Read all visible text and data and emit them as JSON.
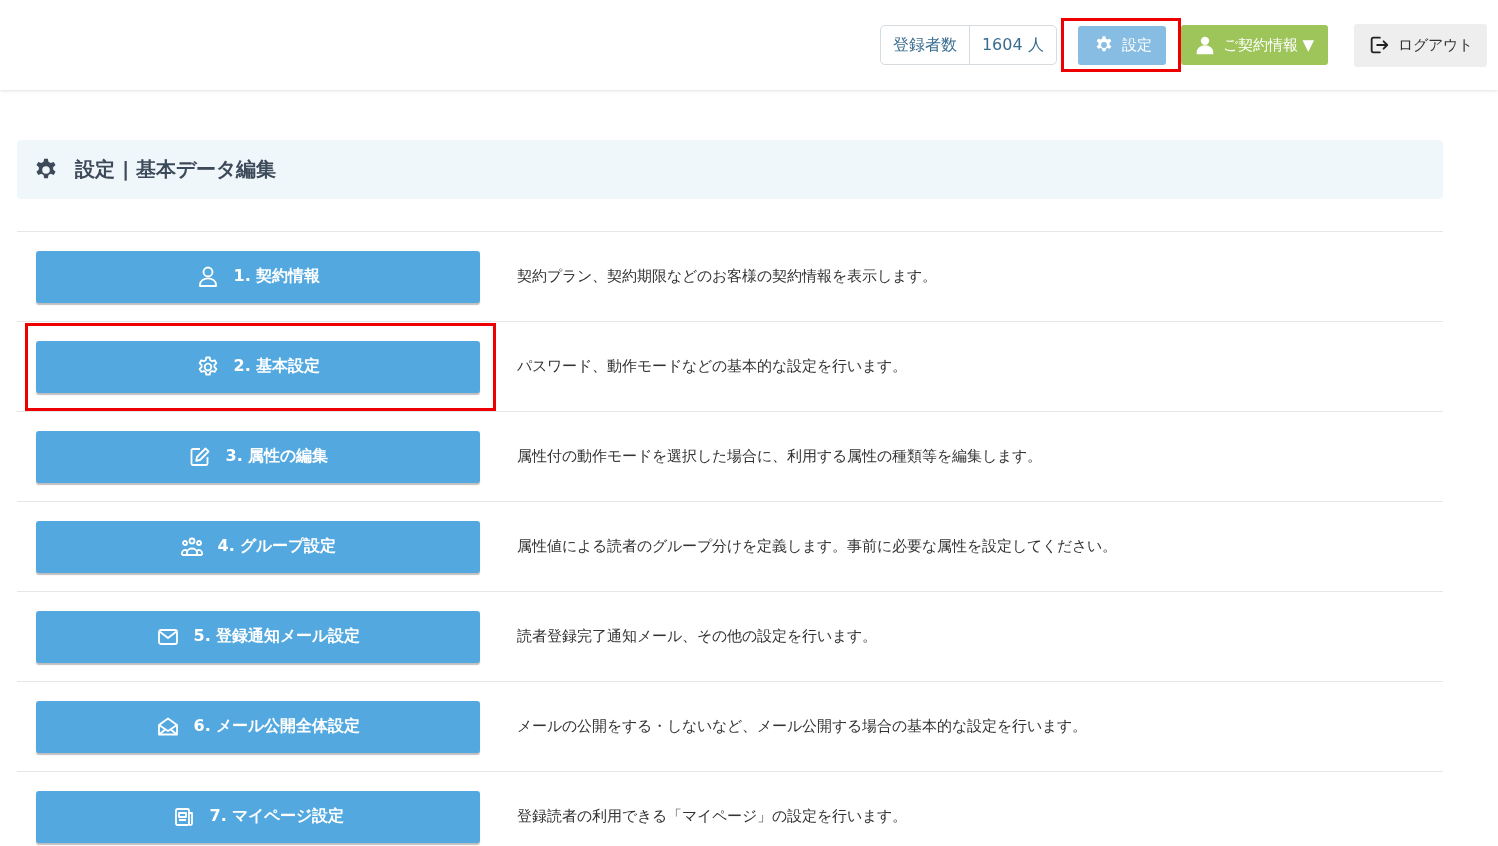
{
  "header": {
    "subscriber_count": {
      "label": "登録者数",
      "value": "1604 人"
    },
    "settings_button": {
      "label": "設定",
      "selected": true,
      "highlighted": true
    },
    "contract_button": {
      "label": "ご契約情報 ▼"
    },
    "logout_button": {
      "label": "ログアウト"
    }
  },
  "page_title": "設定 | 基本データ編集",
  "items": [
    {
      "kind": "person",
      "label": "1. 契約情報",
      "description": "契約プラン、契約期限などのお客様の契約情報を表示します。",
      "highlighted": false
    },
    {
      "kind": "gear",
      "label": "2. 基本設定",
      "description": "パスワード、動作モードなどの基本的な設定を行います。",
      "highlighted": true
    },
    {
      "kind": "edit",
      "label": "3. 属性の編集",
      "description": "属性付の動作モードを選択した場合に、利用する属性の種類等を編集します。",
      "highlighted": false
    },
    {
      "kind": "group",
      "label": "4. グループ設定",
      "description": "属性値による読者のグループ分けを定義します。事前に必要な属性を設定してください。",
      "highlighted": false
    },
    {
      "kind": "mail",
      "label": "5. 登録通知メール設定",
      "description": "読者登録完了通知メール、その他の設定を行います。",
      "highlighted": false
    },
    {
      "kind": "mail-open",
      "label": "6. メール公開全体設定",
      "description": "メールの公開をする・しないなど、メール公開する場合の基本的な設定を行います。",
      "highlighted": false
    },
    {
      "kind": "page",
      "label": "7. マイページ設定",
      "description": "登録読者の利用できる「マイページ」の設定を行います。",
      "highlighted": false
    }
  ]
}
